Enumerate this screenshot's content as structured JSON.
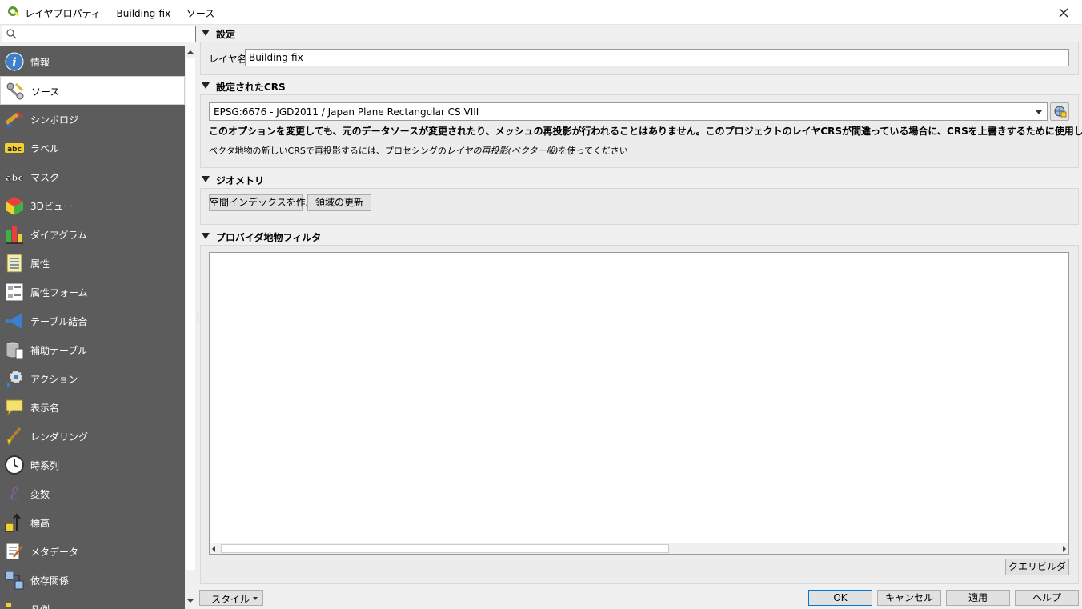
{
  "window": {
    "title": "レイヤプロパティ — Building-fix — ソース"
  },
  "search": {
    "placeholder": "",
    "value": ""
  },
  "sidebar": {
    "items": [
      {
        "label": "情報",
        "icon": "info-icon"
      },
      {
        "label": "ソース",
        "icon": "source-icon",
        "active": true
      },
      {
        "label": "シンボロジ",
        "icon": "symbology-icon"
      },
      {
        "label": "ラベル",
        "icon": "labels-icon"
      },
      {
        "label": "マスク",
        "icon": "mask-icon"
      },
      {
        "label": "3Dビュー",
        "icon": "3d-view-icon"
      },
      {
        "label": "ダイアグラム",
        "icon": "diagram-icon"
      },
      {
        "label": "属性",
        "icon": "attributes-icon"
      },
      {
        "label": "属性フォーム",
        "icon": "attributes-form-icon"
      },
      {
        "label": "テーブル結合",
        "icon": "joins-icon"
      },
      {
        "label": "補助テーブル",
        "icon": "auxiliary-storage-icon"
      },
      {
        "label": "アクション",
        "icon": "actions-icon"
      },
      {
        "label": "表示名",
        "icon": "display-icon"
      },
      {
        "label": "レンダリング",
        "icon": "rendering-icon"
      },
      {
        "label": "時系列",
        "icon": "temporal-icon"
      },
      {
        "label": "変数",
        "icon": "variables-icon"
      },
      {
        "label": "標高",
        "icon": "elevation-icon"
      },
      {
        "label": "メタデータ",
        "icon": "metadata-icon"
      },
      {
        "label": "依存関係",
        "icon": "dependencies-icon"
      },
      {
        "label": "凡例",
        "icon": "legend-icon"
      }
    ]
  },
  "settings": {
    "title": "設定",
    "layer_name_label": "レイヤ名",
    "layer_name_value": "Building-fix"
  },
  "crs": {
    "title": "設定されたCRS",
    "selected": "EPSG:6676 - JGD2011 / Japan Plane Rectangular CS VIII",
    "warning": "このオプションを変更しても、元のデータソースが変更されたり、メッシュの再投影が行われることはありません。このプロジェクトのレイヤCRSが間違っている場合に、CRSを上書きするために使用します。",
    "note_prefix": "ベクタ地物の新しいCRSで再投影するには、プロセシングの",
    "note_italic": "レイヤの再投影(ベクタ一般)",
    "note_suffix": "を使ってください"
  },
  "geometry": {
    "title": "ジオメトリ",
    "create_index_label": "空間インデックスを作成",
    "update_extent_label": "領域の更新"
  },
  "filter": {
    "title": "プロバイダ地物フィルタ",
    "value": "",
    "query_builder_label": "クエリビルダ"
  },
  "footer": {
    "style_label": "スタイル",
    "ok_label": "OK",
    "cancel_label": "キャンセル",
    "apply_label": "適用",
    "help_label": "ヘルプ"
  },
  "colors": {
    "sidebar_bg": "#5c5c5c",
    "accent": "#0078d7"
  }
}
